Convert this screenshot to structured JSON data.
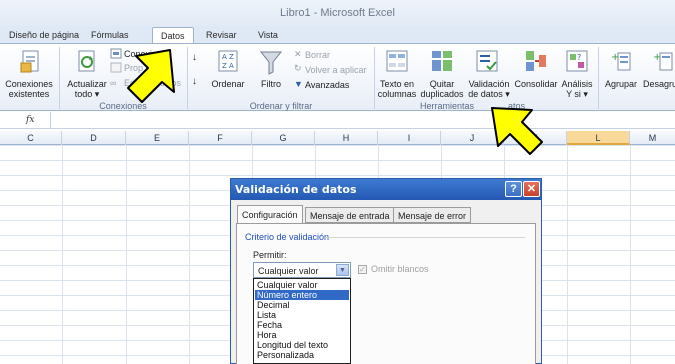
{
  "window": {
    "title": "Libro1 - Microsoft Excel"
  },
  "tabs": [
    {
      "label": "Diseño de página"
    },
    {
      "label": "Fórmulas"
    },
    {
      "label": "Datos",
      "active": true
    },
    {
      "label": "Revisar"
    },
    {
      "label": "Vista"
    }
  ],
  "ribbon": {
    "conexiones_existentes": [
      "Conexiones",
      "existentes"
    ],
    "actualizar": [
      "Actualizar",
      "todo ▾"
    ],
    "conexiones": "Conexiones",
    "propiedades": "Prop",
    "editar_vinculos": "Ed",
    "vinculos_tail": "culos",
    "group_conexiones": "Conexiones",
    "ordenar": "Ordenar",
    "filtro": "Filtro",
    "borrar": "Borrar",
    "volver_aplicar": "Volver a aplicar",
    "avanzadas": "Avanzadas",
    "group_ordenar": "Ordenar y filtrar",
    "texto_columnas": [
      "Texto en",
      "columnas"
    ],
    "quitar_duplicados": [
      "Quitar",
      "duplicados"
    ],
    "validacion": [
      "Validación",
      "de datos ▾"
    ],
    "consolidar": "Consolidar",
    "analisis": [
      "Análisis",
      "Y si ▾"
    ],
    "group_herramientas_a": "Herramientas",
    "group_herramientas_b": "atos",
    "agrupar": "Agrupar",
    "desagrupar": "Desagrup"
  },
  "formula_bar": {
    "fx": "fx"
  },
  "columns": [
    "C",
    "D",
    "E",
    "F",
    "G",
    "H",
    "I",
    "J",
    "K",
    "L",
    "M"
  ],
  "selected_column": "L",
  "dialog": {
    "title": "Validación de datos",
    "help": "?",
    "close": "✕",
    "tabs": [
      "Configuración",
      "Mensaje de entrada",
      "Mensaje de error"
    ],
    "section": "Criterio de validación",
    "permitir_label": "Permitir:",
    "permitir_value": "Cualquier valor",
    "omitir_blancos": "Omitir blancos",
    "options": [
      "Cualquier valor",
      "Número entero",
      "Decimal",
      "Lista",
      "Fecha",
      "Hora",
      "Longitud del texto",
      "Personalizada"
    ],
    "highlighted_option": "Número entero"
  },
  "colors": {
    "arrow_fill": "#ffff00",
    "dialog_title": "#2458b3",
    "selected_col": "#f9d99a"
  }
}
